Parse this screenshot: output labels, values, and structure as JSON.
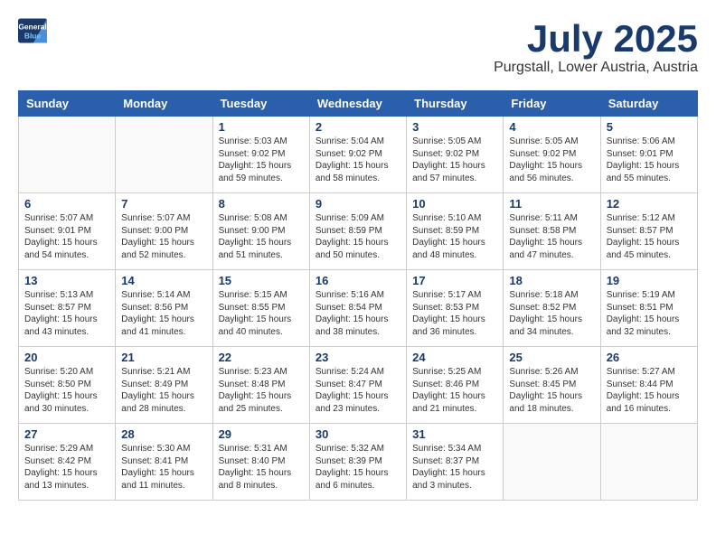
{
  "header": {
    "logo_line1": "General",
    "logo_line2": "Blue",
    "month_year": "July 2025",
    "location": "Purgstall, Lower Austria, Austria"
  },
  "weekdays": [
    "Sunday",
    "Monday",
    "Tuesday",
    "Wednesday",
    "Thursday",
    "Friday",
    "Saturday"
  ],
  "weeks": [
    [
      {
        "day": "",
        "info": ""
      },
      {
        "day": "",
        "info": ""
      },
      {
        "day": "1",
        "info": "Sunrise: 5:03 AM\nSunset: 9:02 PM\nDaylight: 15 hours\nand 59 minutes."
      },
      {
        "day": "2",
        "info": "Sunrise: 5:04 AM\nSunset: 9:02 PM\nDaylight: 15 hours\nand 58 minutes."
      },
      {
        "day": "3",
        "info": "Sunrise: 5:05 AM\nSunset: 9:02 PM\nDaylight: 15 hours\nand 57 minutes."
      },
      {
        "day": "4",
        "info": "Sunrise: 5:05 AM\nSunset: 9:02 PM\nDaylight: 15 hours\nand 56 minutes."
      },
      {
        "day": "5",
        "info": "Sunrise: 5:06 AM\nSunset: 9:01 PM\nDaylight: 15 hours\nand 55 minutes."
      }
    ],
    [
      {
        "day": "6",
        "info": "Sunrise: 5:07 AM\nSunset: 9:01 PM\nDaylight: 15 hours\nand 54 minutes."
      },
      {
        "day": "7",
        "info": "Sunrise: 5:07 AM\nSunset: 9:00 PM\nDaylight: 15 hours\nand 52 minutes."
      },
      {
        "day": "8",
        "info": "Sunrise: 5:08 AM\nSunset: 9:00 PM\nDaylight: 15 hours\nand 51 minutes."
      },
      {
        "day": "9",
        "info": "Sunrise: 5:09 AM\nSunset: 8:59 PM\nDaylight: 15 hours\nand 50 minutes."
      },
      {
        "day": "10",
        "info": "Sunrise: 5:10 AM\nSunset: 8:59 PM\nDaylight: 15 hours\nand 48 minutes."
      },
      {
        "day": "11",
        "info": "Sunrise: 5:11 AM\nSunset: 8:58 PM\nDaylight: 15 hours\nand 47 minutes."
      },
      {
        "day": "12",
        "info": "Sunrise: 5:12 AM\nSunset: 8:57 PM\nDaylight: 15 hours\nand 45 minutes."
      }
    ],
    [
      {
        "day": "13",
        "info": "Sunrise: 5:13 AM\nSunset: 8:57 PM\nDaylight: 15 hours\nand 43 minutes."
      },
      {
        "day": "14",
        "info": "Sunrise: 5:14 AM\nSunset: 8:56 PM\nDaylight: 15 hours\nand 41 minutes."
      },
      {
        "day": "15",
        "info": "Sunrise: 5:15 AM\nSunset: 8:55 PM\nDaylight: 15 hours\nand 40 minutes."
      },
      {
        "day": "16",
        "info": "Sunrise: 5:16 AM\nSunset: 8:54 PM\nDaylight: 15 hours\nand 38 minutes."
      },
      {
        "day": "17",
        "info": "Sunrise: 5:17 AM\nSunset: 8:53 PM\nDaylight: 15 hours\nand 36 minutes."
      },
      {
        "day": "18",
        "info": "Sunrise: 5:18 AM\nSunset: 8:52 PM\nDaylight: 15 hours\nand 34 minutes."
      },
      {
        "day": "19",
        "info": "Sunrise: 5:19 AM\nSunset: 8:51 PM\nDaylight: 15 hours\nand 32 minutes."
      }
    ],
    [
      {
        "day": "20",
        "info": "Sunrise: 5:20 AM\nSunset: 8:50 PM\nDaylight: 15 hours\nand 30 minutes."
      },
      {
        "day": "21",
        "info": "Sunrise: 5:21 AM\nSunset: 8:49 PM\nDaylight: 15 hours\nand 28 minutes."
      },
      {
        "day": "22",
        "info": "Sunrise: 5:23 AM\nSunset: 8:48 PM\nDaylight: 15 hours\nand 25 minutes."
      },
      {
        "day": "23",
        "info": "Sunrise: 5:24 AM\nSunset: 8:47 PM\nDaylight: 15 hours\nand 23 minutes."
      },
      {
        "day": "24",
        "info": "Sunrise: 5:25 AM\nSunset: 8:46 PM\nDaylight: 15 hours\nand 21 minutes."
      },
      {
        "day": "25",
        "info": "Sunrise: 5:26 AM\nSunset: 8:45 PM\nDaylight: 15 hours\nand 18 minutes."
      },
      {
        "day": "26",
        "info": "Sunrise: 5:27 AM\nSunset: 8:44 PM\nDaylight: 15 hours\nand 16 minutes."
      }
    ],
    [
      {
        "day": "27",
        "info": "Sunrise: 5:29 AM\nSunset: 8:42 PM\nDaylight: 15 hours\nand 13 minutes."
      },
      {
        "day": "28",
        "info": "Sunrise: 5:30 AM\nSunset: 8:41 PM\nDaylight: 15 hours\nand 11 minutes."
      },
      {
        "day": "29",
        "info": "Sunrise: 5:31 AM\nSunset: 8:40 PM\nDaylight: 15 hours\nand 8 minutes."
      },
      {
        "day": "30",
        "info": "Sunrise: 5:32 AM\nSunset: 8:39 PM\nDaylight: 15 hours\nand 6 minutes."
      },
      {
        "day": "31",
        "info": "Sunrise: 5:34 AM\nSunset: 8:37 PM\nDaylight: 15 hours\nand 3 minutes."
      },
      {
        "day": "",
        "info": ""
      },
      {
        "day": "",
        "info": ""
      }
    ]
  ]
}
